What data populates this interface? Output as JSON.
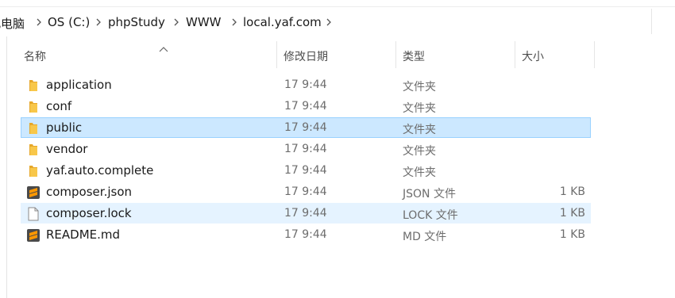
{
  "breadcrumb": {
    "items": [
      "此电脑",
      "OS (C:)",
      "phpStudy",
      "WWW",
      "local.yaf.com"
    ]
  },
  "columns": {
    "name": "名称",
    "date": "修改日期",
    "type": "类型",
    "size": "大小"
  },
  "files": [
    {
      "name": "application",
      "date": "17 9:44",
      "type": "文件夹",
      "size": "",
      "icon": "folder-icon",
      "state": "normal"
    },
    {
      "name": "conf",
      "date": "17 9:44",
      "type": "文件夹",
      "size": "",
      "icon": "folder-icon",
      "state": "normal"
    },
    {
      "name": "public",
      "date": "17 9:44",
      "type": "文件夹",
      "size": "",
      "icon": "folder-icon",
      "state": "selected"
    },
    {
      "name": "vendor",
      "date": "17 9:44",
      "type": "文件夹",
      "size": "",
      "icon": "folder-icon",
      "state": "normal"
    },
    {
      "name": "yaf.auto.complete",
      "date": "17 9:44",
      "type": "文件夹",
      "size": "",
      "icon": "folder-icon",
      "state": "normal"
    },
    {
      "name": "composer.json",
      "date": "17 9:44",
      "type": "JSON 文件",
      "size": "1 KB",
      "icon": "sublime-file-icon",
      "state": "normal"
    },
    {
      "name": "composer.lock",
      "date": "17 9:44",
      "type": "LOCK 文件",
      "size": "1 KB",
      "icon": "blank-file-icon",
      "state": "hover"
    },
    {
      "name": "README.md",
      "date": "17 9:44",
      "type": "MD 文件",
      "size": "1 KB",
      "icon": "sublime-file-icon",
      "state": "normal"
    }
  ],
  "colors": {
    "selected_bg": "#cce8ff",
    "selected_border": "#99d1ff",
    "hover_bg": "#e5f3ff",
    "folder": "#f8c74a",
    "sublime": "#ff9800"
  }
}
